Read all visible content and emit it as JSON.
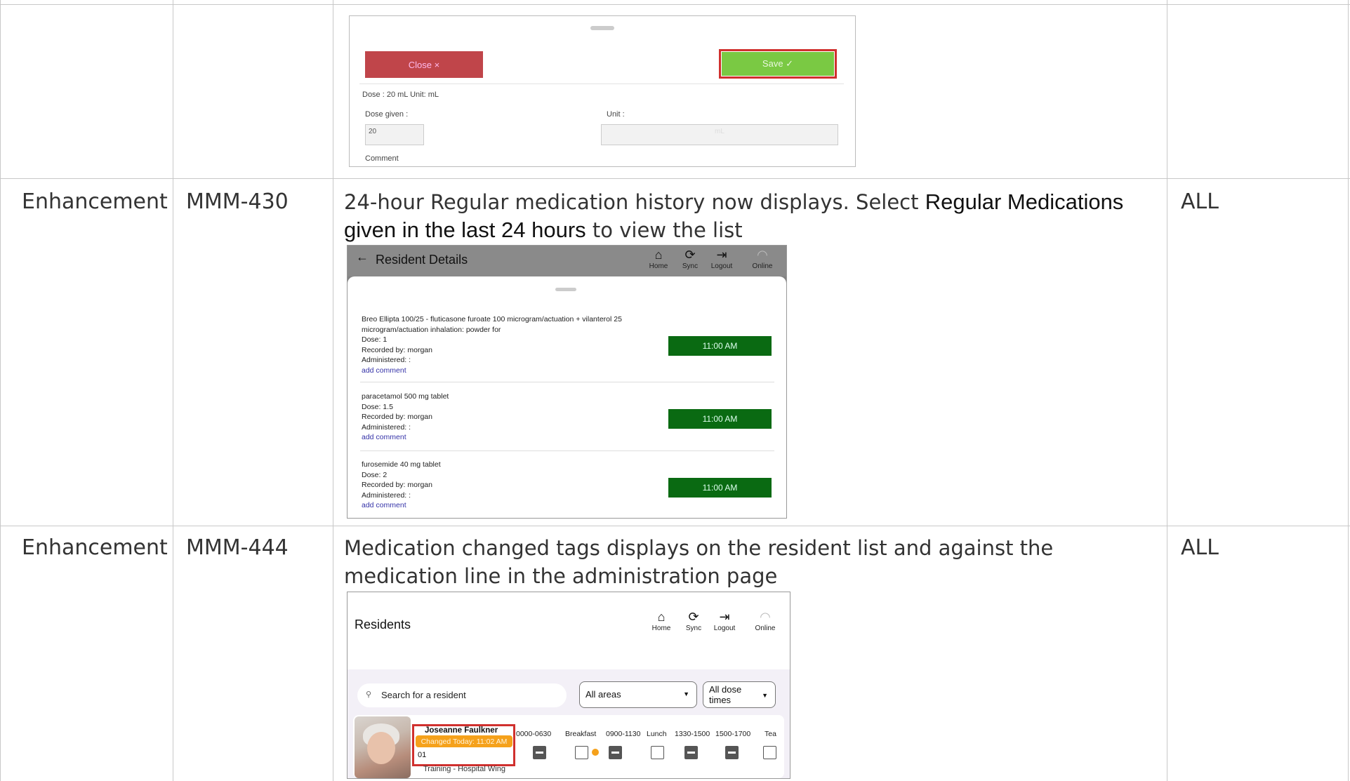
{
  "rows": [
    {
      "type": "",
      "id": "",
      "description_prefix": "",
      "description_bold": "",
      "description_suffix": "",
      "applies": ""
    },
    {
      "type": "Enhancement",
      "id": "MMM-430",
      "description_prefix": "24-hour Regular medication history now displays. Select ",
      "description_bold": "Regular Medications given in the last 24 hours",
      "description_suffix": " to view the list",
      "applies": "ALL"
    },
    {
      "type": "Enhancement",
      "id": "MMM-444",
      "description_prefix": "Medication changed tags displays on the resident list and against the medication line in the administration page",
      "description_bold": "",
      "description_suffix": "",
      "applies": "ALL"
    }
  ],
  "shot1": {
    "close_label": "Close  ×",
    "save_label": "Save  ✓",
    "dose_line": "Dose : 20 mL  Unit: mL",
    "dose_given_label": "Dose given :",
    "dose_given_value": "20",
    "unit_label": "Unit :",
    "unit_value": "mL",
    "comment_label": "Comment"
  },
  "shot2": {
    "title": "Resident Details",
    "nav": [
      {
        "icon": "home-icon",
        "label": "Home"
      },
      {
        "icon": "sync-icon",
        "label": "Sync"
      },
      {
        "icon": "logout-icon",
        "label": "Logout"
      },
      {
        "icon": "wifi-icon",
        "label": "Online"
      }
    ],
    "meds": [
      {
        "name": "Breo Ellipta 100/25 - fluticasone furoate 100 microgram/actuation + vilanterol 25 microgram/actuation inhalation: powder for",
        "dose": "Dose: 1",
        "recorded": "Recorded by: morgan",
        "administered": "Administered:  :",
        "comment": "add comment",
        "time": "11:00 AM"
      },
      {
        "name": "paracetamol 500 mg tablet",
        "dose": "Dose: 1.5",
        "recorded": "Recorded by: morgan",
        "administered": "Administered:  :",
        "comment": "add comment",
        "time": "11:00 AM"
      },
      {
        "name": "furosemide 40 mg tablet",
        "dose": "Dose: 2",
        "recorded": "Recorded by: morgan",
        "administered": "Administered:  :",
        "comment": "add comment",
        "time": "11:00 AM"
      }
    ]
  },
  "shot3": {
    "title": "Residents",
    "search_placeholder": "Search for a resident",
    "areas_select": "All areas",
    "dose_select": "All dose times",
    "resident_name": "Joseanne Faulkner",
    "changed_tag": "Changed Today: 11:02 AM",
    "room": "01",
    "wing": "Training - Hospital Wing",
    "slots": [
      "0000-0630",
      "Breakfast",
      "0900-1130",
      "Lunch",
      "1330-1500",
      "1500-1700",
      "Tea"
    ]
  },
  "colors": {
    "close": "#c0454a",
    "save": "#7ac943",
    "highlight": "#d0302e",
    "time_button": "#0a6a12",
    "changed_tag": "#f5a11b"
  }
}
